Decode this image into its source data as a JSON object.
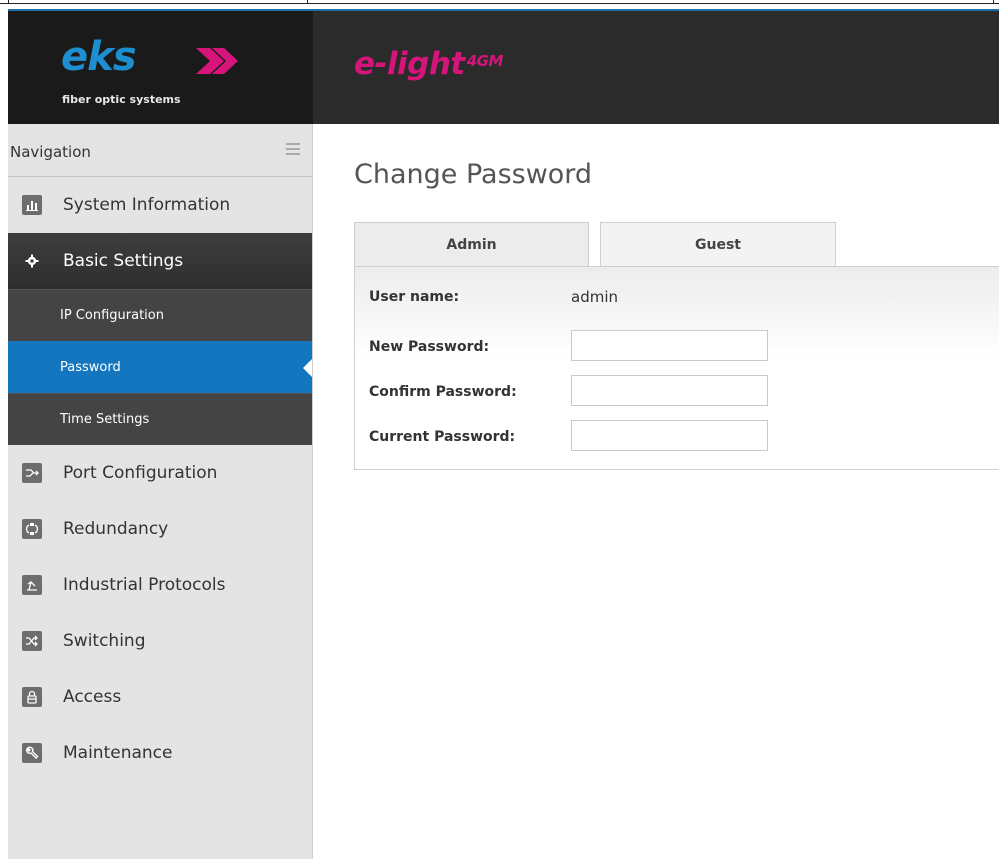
{
  "brand": {
    "logo_text": "eks",
    "tagline": "fiber optic systems",
    "product_name": "e-light",
    "product_suffix": "4GM",
    "logo_color": "#1d8fd0",
    "product_color": "#d6157a"
  },
  "sidebar": {
    "header": "Navigation",
    "items": [
      {
        "label": "System Information",
        "icon": "bar-chart-icon"
      },
      {
        "label": "Basic Settings",
        "icon": "gear-icon"
      },
      {
        "label": "Port Configuration",
        "icon": "port-config-icon"
      },
      {
        "label": "Redundancy",
        "icon": "redundancy-icon"
      },
      {
        "label": "Industrial Protocols",
        "icon": "industrial-protocols-icon"
      },
      {
        "label": "Switching",
        "icon": "switching-icon"
      },
      {
        "label": "Access",
        "icon": "lock-icon"
      },
      {
        "label": "Maintenance",
        "icon": "wrench-icon"
      }
    ],
    "subitems": [
      {
        "label": "IP Configuration"
      },
      {
        "label": "Password"
      },
      {
        "label": "Time Settings"
      }
    ],
    "selected_color": "#1476be"
  },
  "main": {
    "title": "Change Password",
    "tabs": [
      {
        "label": "Admin"
      },
      {
        "label": "Guest"
      }
    ],
    "form": {
      "user_name_label": "User name:",
      "user_name_value": "admin",
      "new_password_label": "New Password:",
      "new_password_value": "",
      "confirm_password_label": "Confirm Password:",
      "confirm_password_value": "",
      "current_password_label": "Current Password:",
      "current_password_value": ""
    }
  }
}
